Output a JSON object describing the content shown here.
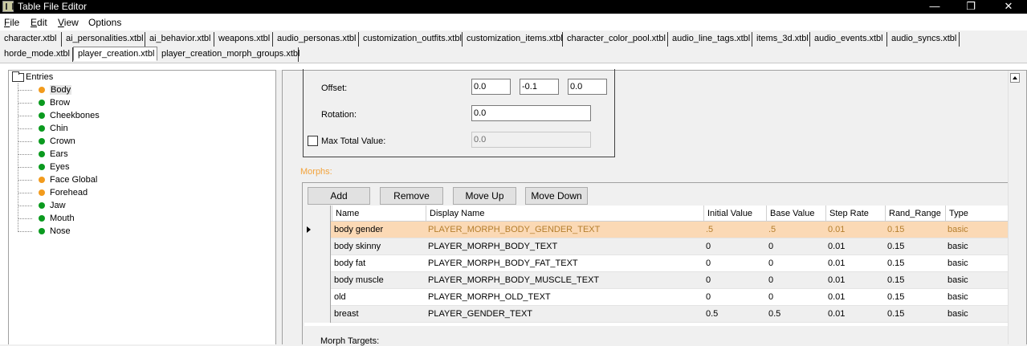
{
  "window": {
    "title": "Table File Editor",
    "minimize": "—",
    "maximize": "❐",
    "close": "✕"
  },
  "menu": [
    {
      "label": "File",
      "accel": "F",
      "rest": "ile"
    },
    {
      "label": "Edit",
      "accel": "E",
      "rest": "dit"
    },
    {
      "label": "View",
      "accel": "V",
      "rest": "iew"
    },
    {
      "label": "Options",
      "accel": "",
      "rest": "Options"
    }
  ],
  "tabs": [
    "character.xtbl",
    "ai_personalities.xtbl",
    "ai_behavior.xtbl",
    "weapons.xtbl",
    "audio_personas.xtbl",
    "customization_outfits.xtbl",
    "customization_items.xtbl",
    "character_color_pool.xtbl",
    "audio_line_tags.xtbl",
    "items_3d.xtbl",
    "audio_events.xtbl",
    "audio_syncs.xtbl",
    "horde_mode.xtbl",
    "player_creation.xtbl",
    "player_creation_morph_groups.xtbl"
  ],
  "active_tab": "player_creation.xtbl",
  "tree": {
    "root": "Entries",
    "items": [
      {
        "label": "Body",
        "status": "orange",
        "selected": true
      },
      {
        "label": "Brow",
        "status": "green"
      },
      {
        "label": "Cheekbones",
        "status": "green"
      },
      {
        "label": "Chin",
        "status": "green"
      },
      {
        "label": "Crown",
        "status": "green"
      },
      {
        "label": "Ears",
        "status": "green"
      },
      {
        "label": "Eyes",
        "status": "green"
      },
      {
        "label": "Face Global",
        "status": "orange"
      },
      {
        "label": "Forehead",
        "status": "orange"
      },
      {
        "label": "Jaw",
        "status": "green"
      },
      {
        "label": "Mouth",
        "status": "green"
      },
      {
        "label": "Nose",
        "status": "green"
      }
    ],
    "colors": {
      "orange": "#f29b1d",
      "green": "#0b9a1f"
    }
  },
  "properties": {
    "offset_label": "Offset:",
    "offset_x": "0.0",
    "offset_y": "-0.1",
    "offset_z": "0.0",
    "rotation_label": "Rotation:",
    "rotation": "0.0",
    "max_total_label": "Max Total Value:",
    "max_total_checked": false,
    "max_total": "0.0"
  },
  "morphs": {
    "label": "Morphs:",
    "buttons": {
      "add": "Add",
      "remove": "Remove",
      "move_up": "Move Up",
      "move_down": "Move Down"
    },
    "columns": [
      "Name",
      "Display Name",
      "Initial Value",
      "Base Value",
      "Step Rate",
      "Rand_Range",
      "Type"
    ],
    "rows": [
      [
        "body gender",
        "PLAYER_MORPH_BODY_GENDER_TEXT",
        ".5",
        ".5",
        "0.01",
        "0.15",
        "basic"
      ],
      [
        "body skinny",
        "PLAYER_MORPH_BODY_TEXT",
        "0",
        "0",
        "0.01",
        "0.15",
        "basic"
      ],
      [
        "body fat",
        "PLAYER_MORPH_BODY_FAT_TEXT",
        "0",
        "0",
        "0.01",
        "0.15",
        "basic"
      ],
      [
        "body muscle",
        "PLAYER_MORPH_BODY_MUSCLE_TEXT",
        "0",
        "0",
        "0.01",
        "0.15",
        "basic"
      ],
      [
        "old",
        "PLAYER_MORPH_OLD_TEXT",
        "0",
        "0",
        "0.01",
        "0.15",
        "basic"
      ],
      [
        "breast",
        "PLAYER_GENDER_TEXT",
        "0.5",
        "0.5",
        "0.01",
        "0.15",
        "basic"
      ]
    ],
    "selected_row_color": "#fbd9b5",
    "alt_row_color": "#efefef"
  },
  "morph_targets_label": "Morph Targets:"
}
